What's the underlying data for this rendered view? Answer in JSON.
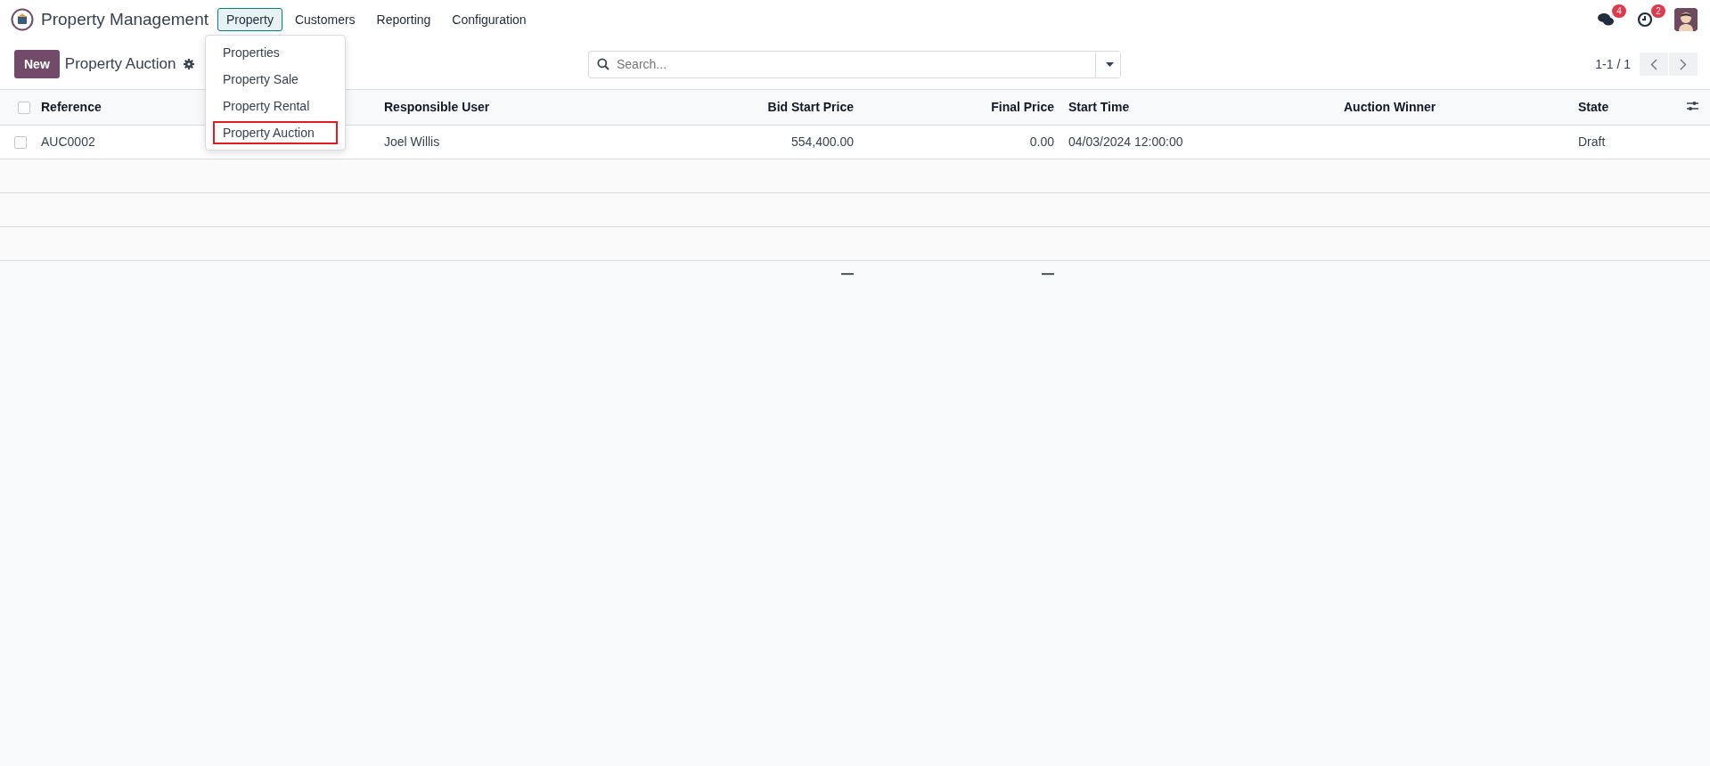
{
  "navbar": {
    "app_title": "Property Management",
    "menu": [
      {
        "label": "Property",
        "selected": true
      },
      {
        "label": "Customers",
        "selected": false
      },
      {
        "label": "Reporting",
        "selected": false
      },
      {
        "label": "Configuration",
        "selected": false
      }
    ],
    "messages_badge": "4",
    "activities_badge": "2"
  },
  "dropdown": {
    "items": [
      {
        "label": "Properties",
        "highlighted": false
      },
      {
        "label": "Property Sale",
        "highlighted": false
      },
      {
        "label": "Property Rental",
        "highlighted": false
      },
      {
        "label": "Property Auction",
        "highlighted": true
      }
    ]
  },
  "control_panel": {
    "new_button": "New",
    "title": "Property Auction",
    "search": {
      "placeholder": "Search..."
    },
    "pager": "1-1 / 1"
  },
  "table": {
    "columns": [
      {
        "label": "Reference",
        "kind": "text"
      },
      {
        "kind": "hidden"
      },
      {
        "label": "Responsible User",
        "kind": "text"
      },
      {
        "label": "Bid Start Price",
        "kind": "number"
      },
      {
        "label": "Final Price",
        "kind": "number"
      },
      {
        "label": "Start Time",
        "kind": "text"
      },
      {
        "label": "Auction Winner",
        "kind": "text"
      },
      {
        "label": "State",
        "kind": "text"
      }
    ],
    "all_selected": false,
    "rows": [
      {
        "selected": false,
        "cells": [
          "AUC0002",
          "",
          "Joel Willis",
          "554,400.00",
          "0.00",
          "04/03/2024 12:00:00",
          "",
          "Draft"
        ]
      }
    ],
    "footer": [
      "—",
      "—"
    ]
  }
}
